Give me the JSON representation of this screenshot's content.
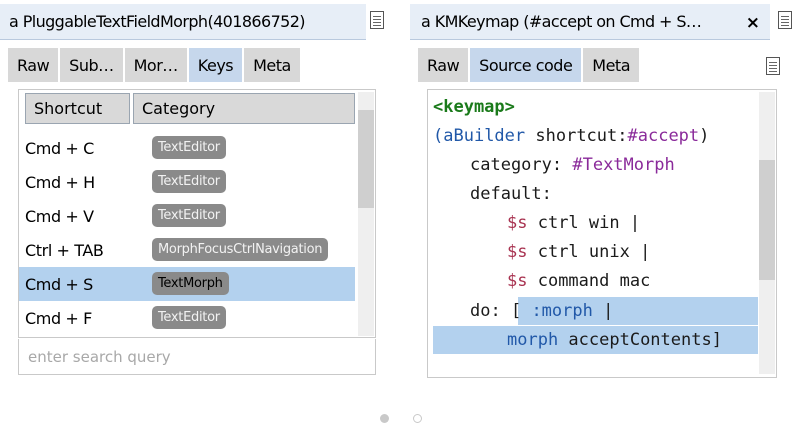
{
  "left_pane": {
    "title": "a PluggableTextFieldMorph(401866752)",
    "tabs": [
      "Raw",
      "Sub…",
      "Mor…",
      "Keys",
      "Meta"
    ],
    "active_tab": "Keys",
    "columns": [
      "Shortcut",
      "Category"
    ],
    "rows": [
      {
        "shortcut": "Cmd + C",
        "category": "TextEditor"
      },
      {
        "shortcut": "Cmd + H",
        "category": "TextEditor"
      },
      {
        "shortcut": "Cmd + V",
        "category": "TextEditor"
      },
      {
        "shortcut": "Ctrl + TAB",
        "category": "MorphFocusCtrlNavigation"
      },
      {
        "shortcut": "Cmd + S",
        "category": "TextMorph",
        "selected": true
      },
      {
        "shortcut": "Cmd + F",
        "category": "TextEditor"
      }
    ],
    "search_placeholder": "enter search query"
  },
  "right_pane": {
    "title": "a KMKeymap (#accept on Cmd + S…",
    "close_icon": "×",
    "tabs": [
      "Raw",
      "Source code",
      "Meta"
    ],
    "active_tab": "Source code",
    "code": {
      "l1_keyword": "<keymap>",
      "l2_open": "(",
      "l2_builder": "aBuilder",
      "l2_mid": " shortcut:",
      "l2_symbol": "#accept",
      "l2_close": ")",
      "l3_text": "category: ",
      "l3_symbol": "#TextMorph",
      "l4_text": "default:",
      "l5_var": "$s",
      "l5_text": " ctrl win |",
      "l6_var": "$s",
      "l6_text": " ctrl unix |",
      "l7_var": "$s",
      "l7_text": " command mac",
      "l8_do": "do: ",
      "l8_open": "[ ",
      "l8_symbol": ":morph",
      "l8_bar": " |",
      "l9_var": "morph",
      "l9_text": " acceptContents]"
    }
  },
  "pager": {
    "pages": 2,
    "current": 1
  },
  "icons": [
    "document-icon",
    "close-icon"
  ],
  "colors": {
    "title_bar": "#e7eef7",
    "tab": "#d8d8d8",
    "tab_active": "#c6d7ec",
    "selection": "#b3d1ee",
    "badge": "#8a8a8a",
    "keyword": "#1a7a1a",
    "symbol": "#8a2a9a",
    "variable": "#a83250"
  }
}
